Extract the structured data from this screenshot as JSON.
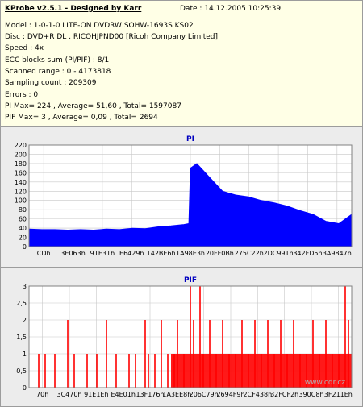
{
  "header": {
    "app": "KProbe v2.5.1 - Designed by Karr",
    "date": "Date : 14.12.2005 10:25:39"
  },
  "info": [
    "Model : 1-0-1-0 LITE-ON DVDRW SOHW-1693S KS02",
    "Disc : DVD+R DL , RICOHJPND00 [Ricoh Company Limited]",
    "Speed : 4x",
    "ECC blocks sum (PI/PIF) : 8/1",
    "Scanned range : 0 - 4173818",
    "Sampling count : 209309",
    "Errors : 0",
    "PI Max= 224 , Average= 51,60 , Total= 1597087",
    "PIF Max= 3 , Average= 0,09 , Total= 2694"
  ],
  "watermark": "www.cdr.cz",
  "colors": {
    "pi": "#0000ff",
    "pif": "#ff0000",
    "title": "#0000c0",
    "panel": "#ececec",
    "plot_bg": "#ffffff",
    "grid": "#c8c8c8"
  },
  "chart_data": [
    {
      "type": "area",
      "title": "PI",
      "ylim": [
        0,
        220
      ],
      "yticks": [
        0,
        20,
        40,
        60,
        80,
        100,
        120,
        140,
        160,
        180,
        200,
        220
      ],
      "x_tick_labels": [
        "CDh",
        "3E063h",
        "91E31h",
        "E6429h",
        "142BE6h",
        "1A98E3h",
        "20FF0Bh",
        "275C22h",
        "2DC991h",
        "342FD5h",
        "3A9847h"
      ],
      "grid": true,
      "x": [
        0,
        4,
        8,
        12,
        16,
        20,
        24,
        28,
        32,
        36,
        40,
        44,
        48,
        49.5,
        50,
        52,
        56,
        60,
        64,
        68,
        72,
        76,
        80,
        84,
        88,
        92,
        96,
        100
      ],
      "values": [
        38,
        37,
        37,
        36,
        37,
        36,
        38,
        37,
        40,
        39,
        43,
        45,
        48,
        50,
        170,
        180,
        150,
        120,
        112,
        108,
        100,
        95,
        88,
        78,
        70,
        55,
        50,
        70
      ]
    },
    {
      "type": "bar",
      "title": "PIF",
      "ylim": [
        0,
        3
      ],
      "yticks": [
        0,
        0.5,
        1,
        1.5,
        2,
        2.5,
        3
      ],
      "ytick_labels": [
        "0",
        "0,5",
        "1",
        "1,5",
        "2",
        "2,5",
        "3"
      ],
      "x_tick_labels": [
        "70h",
        "3C470h",
        "91E1Eh",
        "E4E01h",
        "13F176h",
        "1A3EE8h",
        "206C79h",
        "2694F9h",
        "2CF438h",
        "32FCF2h",
        "390C8h",
        "3F211Eh"
      ],
      "grid": true,
      "x": [
        3,
        5,
        8,
        12,
        14,
        18,
        21,
        24,
        27,
        31,
        33,
        36,
        37,
        39,
        41,
        43,
        45,
        46,
        48,
        50,
        51,
        53,
        54,
        56,
        58,
        60,
        62,
        64,
        66,
        68,
        70,
        72,
        74,
        76,
        78,
        80,
        82,
        84,
        86,
        88,
        90,
        92,
        94,
        96,
        98,
        99
      ],
      "values": [
        1,
        1,
        1,
        2,
        1,
        1,
        1,
        2,
        1,
        1,
        1,
        2,
        1,
        1,
        2,
        1,
        1,
        2,
        1,
        3,
        2,
        3,
        1,
        2,
        1,
        2,
        1,
        1,
        2,
        1,
        2,
        1,
        2,
        1,
        2,
        1,
        2,
        1,
        1,
        2,
        1,
        2,
        1,
        1,
        3,
        2
      ]
    }
  ]
}
